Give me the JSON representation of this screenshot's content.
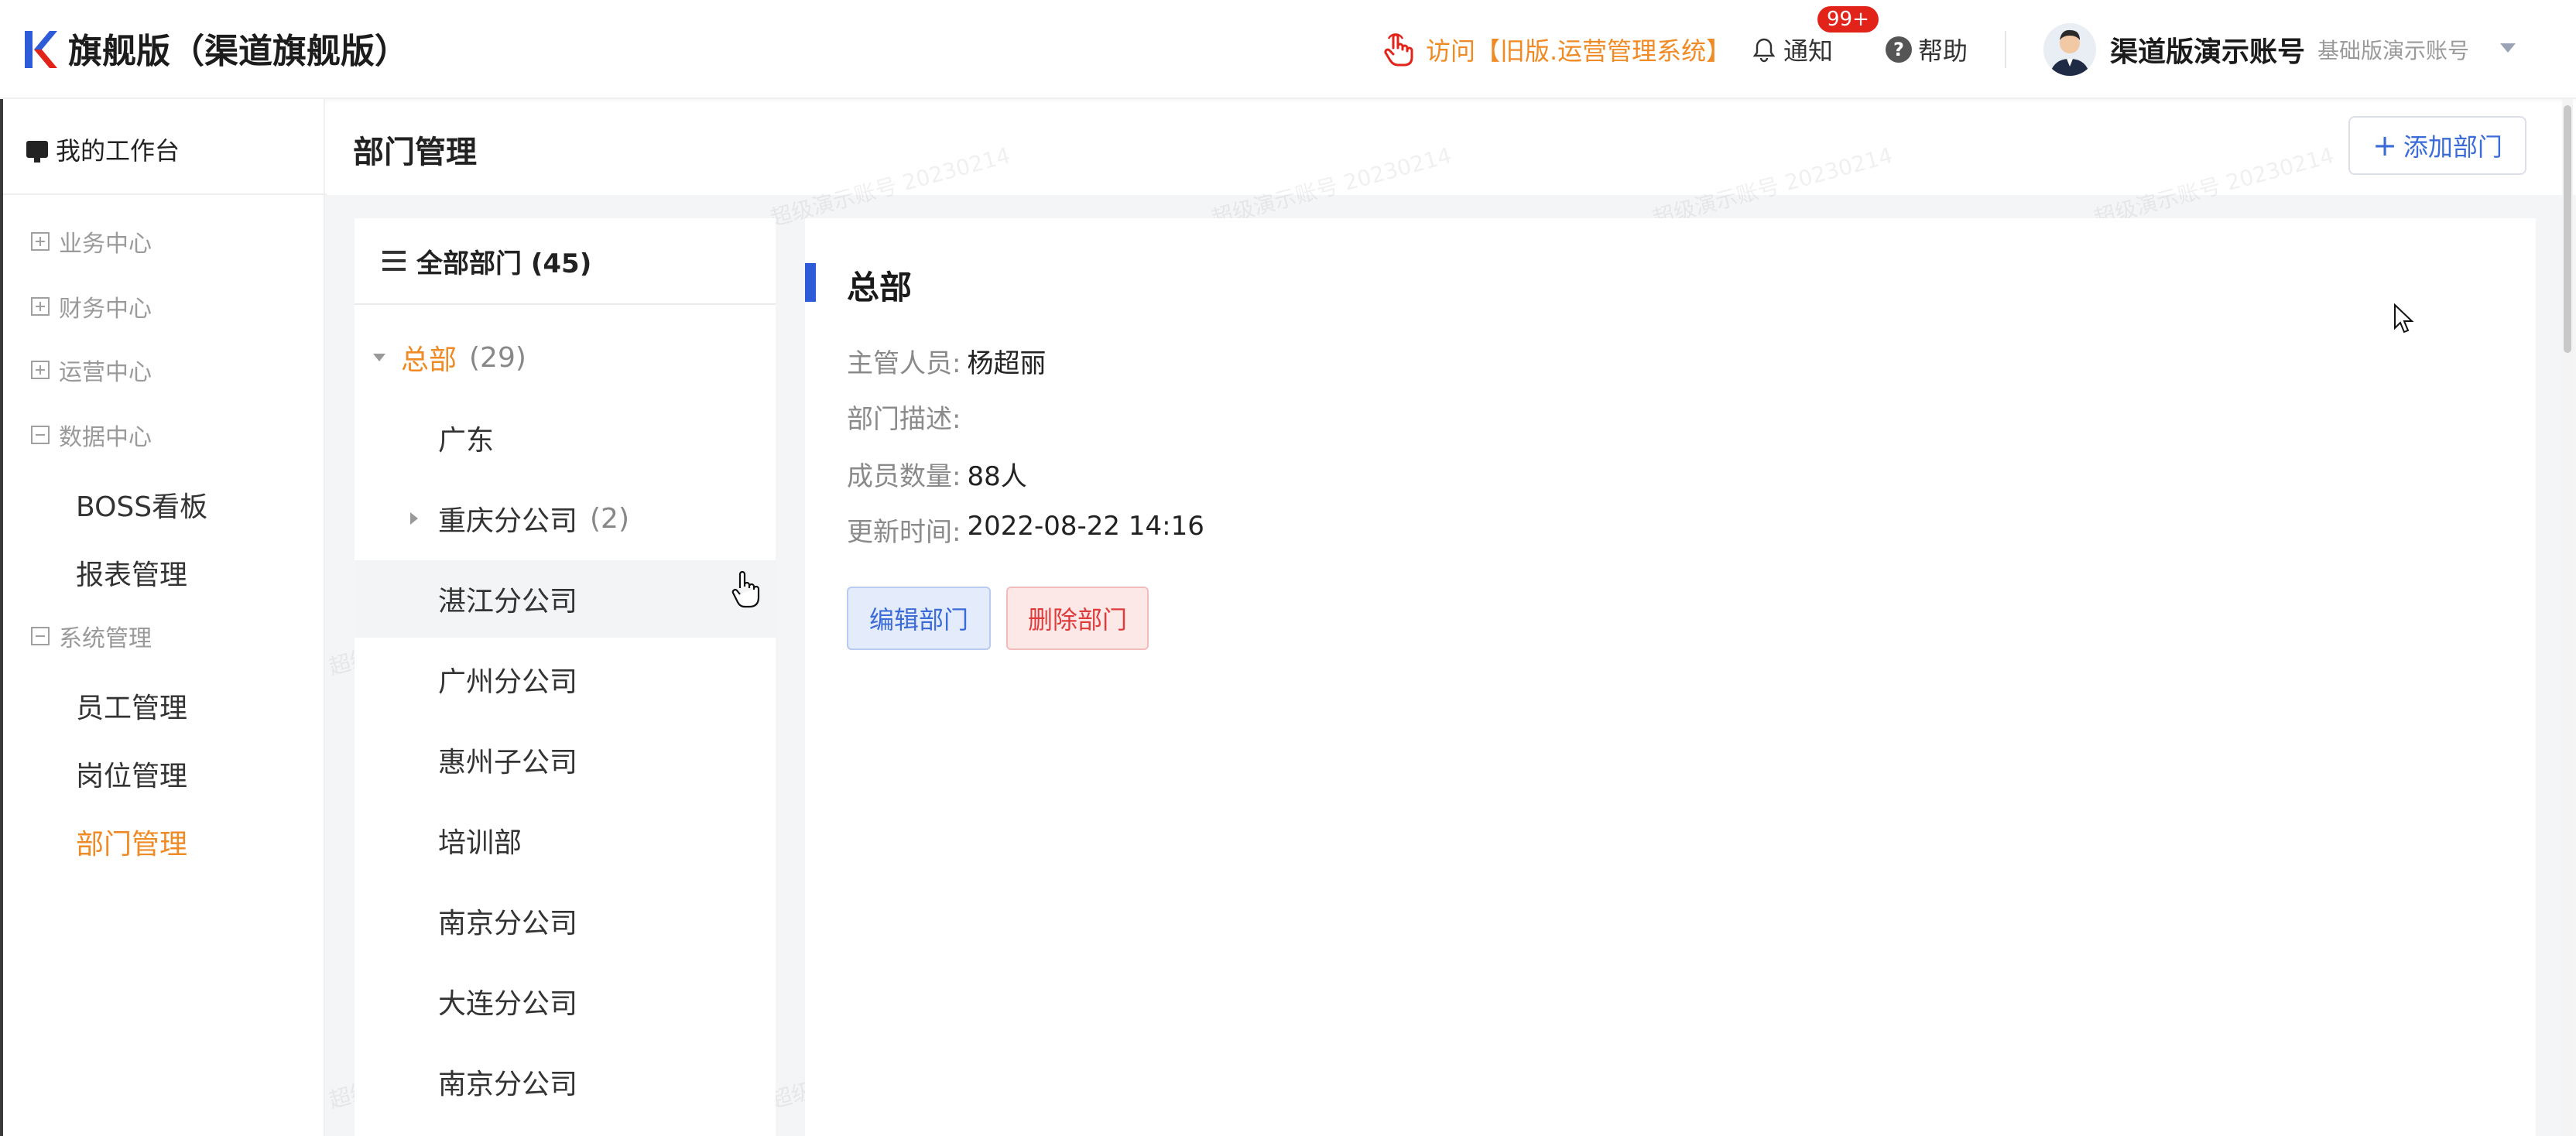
{
  "header": {
    "app_title": "旗舰版（渠道旗舰版）",
    "visit_link": "访问【旧版.运营管理系统】",
    "notify_label": "通知",
    "notify_badge": "99+",
    "help_label": "帮助",
    "account_name": "渠道版演示账号",
    "account_sub": "基础版演示账号",
    "accent_color": "#f08a24",
    "brand_color": "#2e5bd8"
  },
  "sidebar": {
    "workbench": "我的工作台",
    "groups": [
      {
        "label": "业务中心",
        "state": "collapsed"
      },
      {
        "label": "财务中心",
        "state": "collapsed"
      },
      {
        "label": "运营中心",
        "state": "collapsed"
      },
      {
        "label": "数据中心",
        "state": "expanded"
      },
      {
        "label": "系统管理",
        "state": "expanded"
      }
    ],
    "data_center_items": [
      "BOSS看板",
      "报表管理"
    ],
    "system_items": [
      "员工管理",
      "岗位管理",
      "部门管理"
    ],
    "active_item": "部门管理"
  },
  "page": {
    "title": "部门管理",
    "add_button": "添加部门"
  },
  "tree": {
    "header": "全部部门 (45)",
    "nodes": [
      {
        "label": "总部",
        "count": "(29)",
        "expanded": true
      },
      {
        "label": "广东",
        "count": ""
      },
      {
        "label": "重庆分公司",
        "count": "(2)",
        "expanded": false
      },
      {
        "label": "湛江分公司",
        "count": ""
      },
      {
        "label": "广州分公司",
        "count": ""
      },
      {
        "label": "惠州子公司",
        "count": ""
      },
      {
        "label": "培训部",
        "count": ""
      },
      {
        "label": "南京分公司",
        "count": ""
      },
      {
        "label": "大连分公司",
        "count": ""
      },
      {
        "label": "南京分公司",
        "count": ""
      }
    ]
  },
  "detail": {
    "title": "总部",
    "manager_label": "主管人员:",
    "manager_value": "杨超丽",
    "desc_label": "部门描述:",
    "desc_value": "",
    "members_label": "成员数量:",
    "members_value": "88人",
    "updated_label": "更新时间:",
    "updated_value": "2022-08-22 14:16",
    "edit_button": "编辑部门",
    "delete_button": "删除部门"
  },
  "watermark": "超级演示账号 20230214"
}
